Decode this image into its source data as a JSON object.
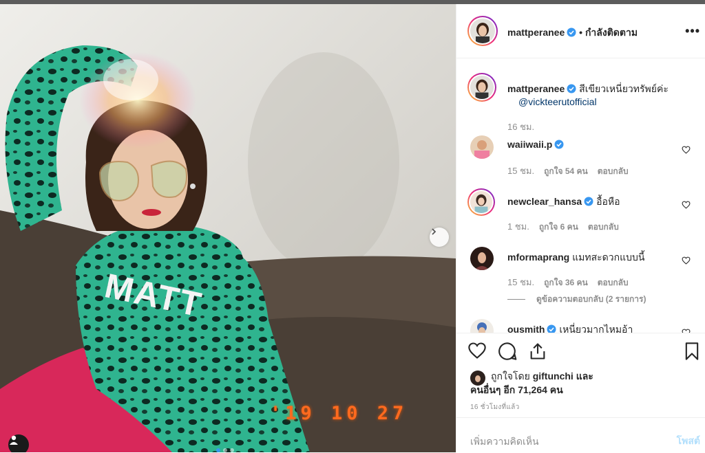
{
  "post": {
    "username": "mattperanee",
    "follow_status": "• กำลังติดตาม",
    "more_label": "•••",
    "date_stamp": "'19 10 27",
    "caption": {
      "username": "mattperanee",
      "text": "สีเขียวเหนี่ยวทรัพย์ค่ะ",
      "mention": "@vickteerutofficial",
      "time": "16 ชม."
    },
    "comments": [
      {
        "username": "waiiwaii.p",
        "verified": true,
        "text": "",
        "time": "15 ชม.",
        "likes": "ถูกใจ 54 คน",
        "reply": "ตอบกลับ"
      },
      {
        "username": "newclear_hansa",
        "verified": true,
        "text": "อื้อหือ",
        "time": "1 ชม.",
        "likes": "ถูกใจ 6 คน",
        "reply": "ตอบกลับ"
      },
      {
        "username": "mformaprang",
        "verified": false,
        "text": "แมทสะดวกแบบนี้",
        "time": "15 ชม.",
        "likes": "ถูกใจ 36 คน",
        "reply": "ตอบกลับ",
        "view_replies": "ดูข้อความตอบกลับ (2 รายการ)"
      },
      {
        "username": "ousmith",
        "verified": true,
        "text": "เหนี่ยวมากไหมอ้า"
      }
    ],
    "liked_by_prefix": "ถูกใจโดย",
    "liked_by_user": "giftunchi",
    "liked_by_and": "และ",
    "liked_by_others": "คนอื่นๆ อีก 71,264 คน",
    "posted_ago": "16 ชั่วโมงที่แล้ว",
    "add_comment_placeholder": "เพิ่มความคิดเห็น",
    "post_button": "โพสต์"
  },
  "colors": {
    "verified": "#3897f0",
    "link": "#003569",
    "muted": "#8e8e8e",
    "post_disabled": "#b2dffc",
    "date_stamp": "#ff6a1e"
  },
  "icons": [
    "verified-icon",
    "heart-icon",
    "comment-icon",
    "share-icon",
    "bookmark-icon",
    "more-icon",
    "next-arrow-icon",
    "user-tag-icon"
  ]
}
